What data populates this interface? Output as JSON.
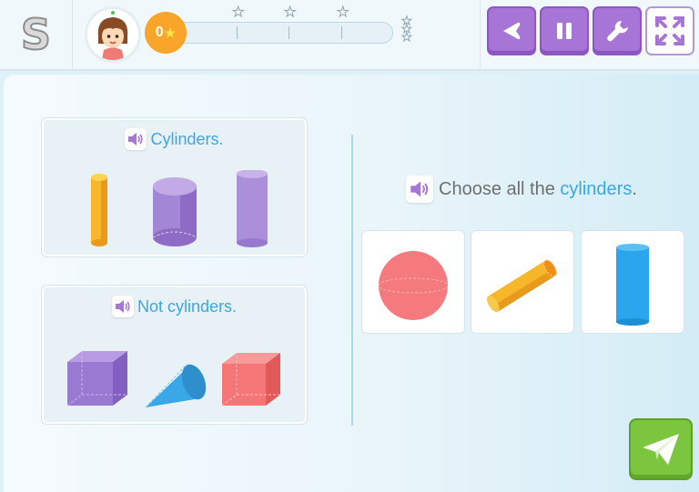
{
  "app": {
    "logo_letter": "S"
  },
  "header": {
    "coins": "0",
    "progress_percent": 0,
    "buttons": [
      "back",
      "pause",
      "settings",
      "fullscreen"
    ]
  },
  "examples": {
    "positive_title": "Cylinders.",
    "negative_title": "Not cylinders."
  },
  "question": {
    "prefix": "Choose all the ",
    "highlight": "cylinders",
    "suffix": "."
  },
  "choices": [
    "sphere",
    "cylinder-lying",
    "cylinder-standing"
  ],
  "colors": {
    "accent_purple": "#a775d6",
    "accent_blue": "#3aa8e6",
    "submit_green": "#7cc53f",
    "coin_orange": "#f8a529"
  },
  "icons": [
    "speaker-icon",
    "back-icon",
    "pause-icon",
    "wrench-icon",
    "expand-icon",
    "paper-plane-icon",
    "star-icon"
  ]
}
